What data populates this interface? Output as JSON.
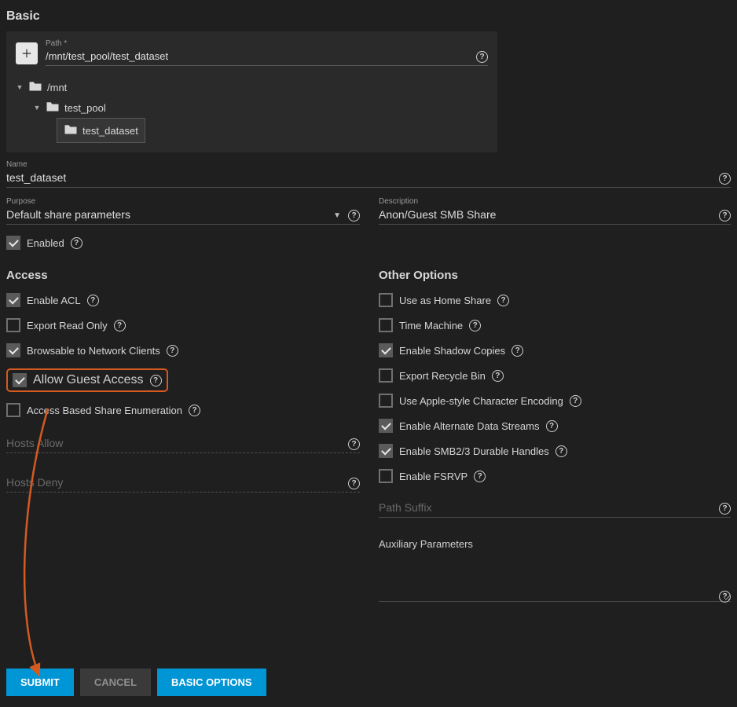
{
  "section_basic": "Basic",
  "path": {
    "label": "Path *",
    "value": "/mnt/test_pool/test_dataset",
    "tree": {
      "root": "/mnt",
      "child": "test_pool",
      "leaf": "test_dataset"
    }
  },
  "name": {
    "label": "Name",
    "value": "test_dataset"
  },
  "purpose": {
    "label": "Purpose",
    "value": "Default share parameters"
  },
  "description": {
    "label": "Description",
    "value": "Anon/Guest SMB Share"
  },
  "enabled": {
    "label": "Enabled",
    "checked": true
  },
  "access": {
    "title": "Access",
    "items": {
      "enable_acl": {
        "label": "Enable ACL",
        "checked": true
      },
      "export_ro": {
        "label": "Export Read Only",
        "checked": false
      },
      "browsable": {
        "label": "Browsable to Network Clients",
        "checked": true
      },
      "guest": {
        "label": "Allow Guest Access",
        "checked": true
      },
      "abse": {
        "label": "Access Based Share Enumeration",
        "checked": false
      }
    },
    "hosts_allow": {
      "label": "Hosts Allow",
      "value": ""
    },
    "hosts_deny": {
      "label": "Hosts Deny",
      "value": ""
    }
  },
  "other": {
    "title": "Other Options",
    "items": {
      "home_share": {
        "label": "Use as Home Share",
        "checked": false
      },
      "time_machine": {
        "label": "Time Machine",
        "checked": false
      },
      "shadow": {
        "label": "Enable Shadow Copies",
        "checked": true
      },
      "recycle": {
        "label": "Export Recycle Bin",
        "checked": false
      },
      "apple_enc": {
        "label": "Use Apple-style Character Encoding",
        "checked": false
      },
      "ads": {
        "label": "Enable Alternate Data Streams",
        "checked": true
      },
      "durable": {
        "label": "Enable SMB2/3 Durable Handles",
        "checked": true
      },
      "fsrvp": {
        "label": "Enable FSRVP",
        "checked": false
      }
    },
    "path_suffix": {
      "label": "Path Suffix",
      "value": ""
    },
    "aux_params": {
      "label": "Auxiliary Parameters",
      "value": ""
    }
  },
  "buttons": {
    "submit": "SUBMIT",
    "cancel": "CANCEL",
    "basic_options": "BASIC OPTIONS"
  }
}
